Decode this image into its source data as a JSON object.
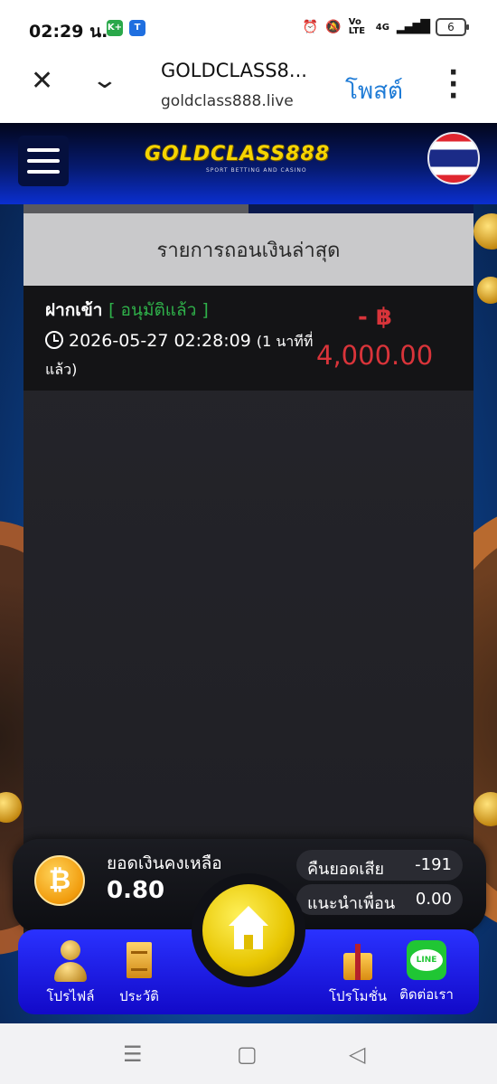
{
  "status_bar": {
    "time": "02:29 น.",
    "badge1": "K+",
    "badge2": "T",
    "network": "Vo LTE",
    "signal": "4G",
    "battery": "6"
  },
  "browser": {
    "close_icon": "close-icon",
    "chevron_icon": "chevron-down-icon",
    "title": "GOLDCLASS8...",
    "url": "goldclass888.live",
    "post_label": "โพสต์",
    "more_icon": "more-vertical-icon"
  },
  "header": {
    "logo_text": "GOLDCLASS888",
    "logo_subtext": "SPORT BETTING AND CASINO"
  },
  "panel": {
    "title": "รายการถอนเงินล่าสุด",
    "transactions": [
      {
        "type": "ฝากเข้า",
        "status": "[ อนุมัติแล้ว ]",
        "datetime": "2026-05-27 02:28:09",
        "ago": "(1 นาทีที่แล้ว)",
        "sign": "- ฿",
        "amount": "4,000.00"
      }
    ]
  },
  "balance": {
    "label": "ยอดเงินคงเหลือ",
    "value": "0.80",
    "coin_symbol": "₿",
    "cashback_label": "คืนยอดเสีย",
    "cashback_value": "-191",
    "referral_label": "แนะนำเพื่อน",
    "referral_value": "0.00"
  },
  "nav": {
    "items": [
      {
        "label": "โปรไฟล์"
      },
      {
        "label": "ประวัติ"
      },
      {
        "label": "โปรโมชั่น"
      },
      {
        "label": "ติดต่อเรา"
      }
    ],
    "line_text": "LINE"
  },
  "system_nav": {
    "recents": "☰",
    "home": "▢",
    "back": "◁"
  },
  "colors": {
    "accent_gold": "#f5d400",
    "status_green": "#2fb14a",
    "amount_red": "#d9343a",
    "nav_blue": "#1e1ee6"
  }
}
